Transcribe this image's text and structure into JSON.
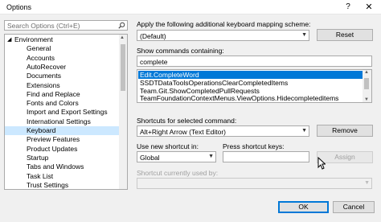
{
  "window": {
    "title": "Options",
    "help_glyph": "?",
    "close_glyph": "✕"
  },
  "search": {
    "placeholder": "Search Options (Ctrl+E)"
  },
  "tree": {
    "items": [
      {
        "label": "Environment",
        "expanded": true,
        "level": 0
      },
      {
        "label": "General",
        "level": 1
      },
      {
        "label": "Accounts",
        "level": 1
      },
      {
        "label": "AutoRecover",
        "level": 1
      },
      {
        "label": "Documents",
        "level": 1
      },
      {
        "label": "Extensions",
        "level": 1
      },
      {
        "label": "Find and Replace",
        "level": 1
      },
      {
        "label": "Fonts and Colors",
        "level": 1
      },
      {
        "label": "Import and Export Settings",
        "level": 1
      },
      {
        "label": "International Settings",
        "level": 1
      },
      {
        "label": "Keyboard",
        "level": 1,
        "selected": true
      },
      {
        "label": "Preview Features",
        "level": 1
      },
      {
        "label": "Product Updates",
        "level": 1
      },
      {
        "label": "Startup",
        "level": 1
      },
      {
        "label": "Tabs and Windows",
        "level": 1
      },
      {
        "label": "Task List",
        "level": 1
      },
      {
        "label": "Trust Settings",
        "level": 1
      }
    ]
  },
  "mapping": {
    "label": "Apply the following additional keyboard mapping scheme:",
    "value": "(Default)",
    "reset_label": "Reset"
  },
  "commands": {
    "label": "Show commands containing:",
    "filter_value": "complete",
    "items": [
      {
        "label": "Edit.CompleteWord",
        "selected": true
      },
      {
        "label": "SSDTDataToolsOperationsClearCompletedItems"
      },
      {
        "label": "Team.Git.ShowCompletedPullRequests"
      },
      {
        "label": "TeamFoundationContextMenus.ViewOptions.Hidecompleteditems"
      }
    ]
  },
  "shortcuts": {
    "label": "Shortcuts for selected command:",
    "value": "Alt+Right Arrow (Text Editor)",
    "remove_label": "Remove"
  },
  "new_shortcut": {
    "use_in_label": "Use new shortcut in:",
    "use_in_value": "Global",
    "press_keys_label": "Press shortcut keys:",
    "press_keys_value": "",
    "assign_label": "Assign"
  },
  "used_by": {
    "label": "Shortcut currently used by:",
    "value": ""
  },
  "footer": {
    "ok_label": "OK",
    "cancel_label": "Cancel"
  },
  "icons": {
    "search": "search-icon",
    "close": "close-icon",
    "dropdown": "chevron-down-icon"
  },
  "colors": {
    "selection_blue": "#0078d7",
    "tree_selection": "#cce8ff"
  }
}
